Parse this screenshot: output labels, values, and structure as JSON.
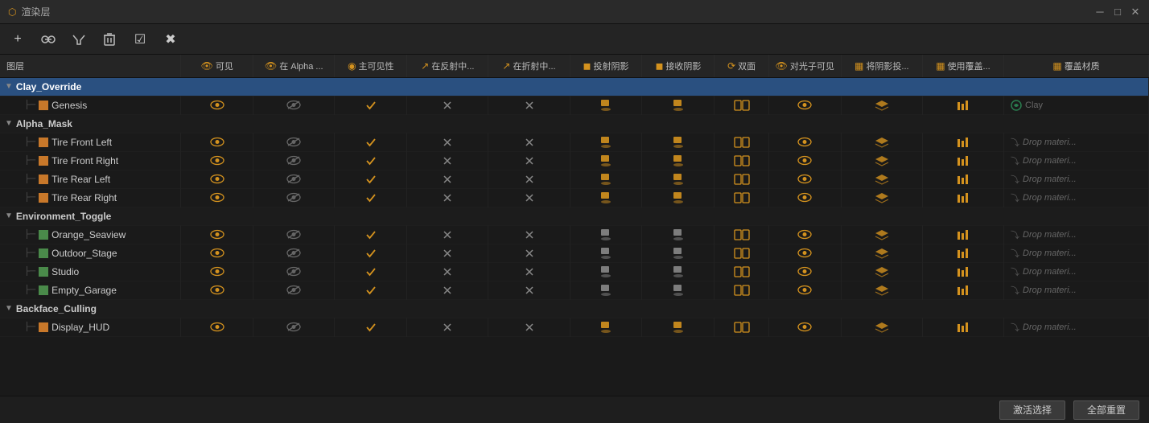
{
  "titlebar": {
    "title": "渲染层",
    "controls": [
      "□",
      "✕"
    ]
  },
  "toolbar": {
    "buttons": [
      "+",
      "⊕",
      "✦",
      "🗑",
      "☑",
      "✖"
    ]
  },
  "table": {
    "headers": [
      {
        "key": "name",
        "label": "图层"
      },
      {
        "key": "visible",
        "label": "可见",
        "icon": "👁"
      },
      {
        "key": "alpha",
        "label": "在 Alpha ...",
        "icon": "👁"
      },
      {
        "key": "mainvis",
        "label": "主可见性",
        "icon": "◉"
      },
      {
        "key": "refl",
        "label": "在反射中...",
        "icon": "↗"
      },
      {
        "key": "refr",
        "label": "在折射中...",
        "icon": "↗"
      },
      {
        "key": "castshadow",
        "label": "投射阴影",
        "icon": "◼"
      },
      {
        "key": "recvshadow",
        "label": "接收阴影",
        "icon": "◼"
      },
      {
        "key": "twosided",
        "label": "双面",
        "icon": "⟳"
      },
      {
        "key": "photovis",
        "label": "对光子可见",
        "icon": "👁"
      },
      {
        "key": "shadowpass",
        "label": "将阴影投...",
        "icon": "◼"
      },
      {
        "key": "usecover",
        "label": "使用覆盖...",
        "icon": "▦"
      },
      {
        "key": "covermaterial",
        "label": "覆盖材质",
        "icon": "▦"
      }
    ],
    "sections": [
      {
        "id": "clay_override",
        "name": "Clay_Override",
        "selected": true,
        "children": [
          {
            "id": "genesis",
            "name": "Genesis",
            "indent": 2,
            "icon_color": "orange",
            "visible": true,
            "alpha": "off",
            "mainvis": true,
            "refl": "x",
            "refr": "x",
            "castshadow": true,
            "recvshadow": true,
            "twosided": true,
            "photovis": true,
            "shadowpass": true,
            "usecover": true,
            "covermaterial": "Clay"
          }
        ]
      },
      {
        "id": "alpha_mask",
        "name": "Alpha_Mask",
        "selected": false,
        "children": [
          {
            "id": "tire_front_left",
            "name": "Tire Front Left",
            "indent": 2,
            "icon_color": "orange",
            "visible": true,
            "alpha": "off",
            "mainvis": true,
            "refl": "x",
            "refr": "x",
            "castshadow": true,
            "recvshadow": true,
            "twosided": true,
            "photovis": true,
            "shadowpass": true,
            "usecover": true,
            "covermaterial": "Drop materi..."
          },
          {
            "id": "tire_front_right",
            "name": "Tire Front Right",
            "indent": 2,
            "icon_color": "orange",
            "visible": true,
            "alpha": "off",
            "mainvis": true,
            "refl": "x",
            "refr": "x",
            "castshadow": true,
            "recvshadow": true,
            "twosided": true,
            "photovis": true,
            "shadowpass": true,
            "usecover": true,
            "covermaterial": "Drop materi..."
          },
          {
            "id": "tire_rear_left",
            "name": "Tire Rear Left",
            "indent": 2,
            "icon_color": "orange",
            "visible": true,
            "alpha": "off",
            "mainvis": true,
            "refl": "x",
            "refr": "x",
            "castshadow": true,
            "recvshadow": true,
            "twosided": true,
            "photovis": true,
            "shadowpass": true,
            "usecover": true,
            "covermaterial": "Drop materi..."
          },
          {
            "id": "tire_rear_right",
            "name": "Tire Rear Right",
            "indent": 2,
            "icon_color": "orange",
            "visible": true,
            "alpha": "off",
            "mainvis": true,
            "refl": "x",
            "refr": "x",
            "castshadow": true,
            "recvshadow": true,
            "twosided": true,
            "photovis": true,
            "shadowpass": true,
            "usecover": true,
            "covermaterial": "Drop materi..."
          }
        ]
      },
      {
        "id": "environment_toggle",
        "name": "Environment_Toggle",
        "selected": false,
        "children": [
          {
            "id": "orange_seaview",
            "name": "Orange_Seaview",
            "indent": 2,
            "icon_color": "green",
            "visible": true,
            "alpha": "off",
            "mainvis": true,
            "refl": "x",
            "refr": "x",
            "castshadow": "gray",
            "recvshadow": "gray",
            "twosided": true,
            "photovis": true,
            "shadowpass": true,
            "usecover": true,
            "covermaterial": "Drop materi..."
          },
          {
            "id": "outdoor_stage",
            "name": "Outdoor_Stage",
            "indent": 2,
            "icon_color": "green",
            "visible": true,
            "alpha": "off",
            "mainvis": true,
            "refl": "x",
            "refr": "x",
            "castshadow": "gray",
            "recvshadow": "gray",
            "twosided": true,
            "photovis": true,
            "shadowpass": true,
            "usecover": true,
            "covermaterial": "Drop materi..."
          },
          {
            "id": "studio",
            "name": "Studio",
            "indent": 2,
            "icon_color": "green",
            "visible": true,
            "alpha": "off",
            "mainvis": true,
            "refl": "x",
            "refr": "x",
            "castshadow": "gray",
            "recvshadow": "gray",
            "twosided": true,
            "photovis": true,
            "shadowpass": true,
            "usecover": true,
            "covermaterial": "Drop materi..."
          },
          {
            "id": "empty_garage",
            "name": "Empty_Garage",
            "indent": 2,
            "icon_color": "green",
            "visible": true,
            "alpha": "off",
            "mainvis": true,
            "refl": "x",
            "refr": "x",
            "castshadow": "gray",
            "recvshadow": "gray",
            "twosided": true,
            "photovis": true,
            "shadowpass": true,
            "usecover": true,
            "covermaterial": "Drop materi..."
          }
        ]
      },
      {
        "id": "backface_culling",
        "name": "Backface_Culling",
        "selected": false,
        "children": [
          {
            "id": "display_hud",
            "name": "Display_HUD",
            "indent": 2,
            "icon_color": "orange",
            "visible": true,
            "alpha": "off",
            "mainvis": true,
            "refl": "x",
            "refr": "x",
            "castshadow": true,
            "recvshadow": true,
            "twosided": true,
            "photovis": true,
            "shadowpass": true,
            "usecover": true,
            "covermaterial": "Drop materi..."
          }
        ]
      }
    ]
  },
  "bottombar": {
    "activate_label": "激活选择",
    "reset_label": "全部重置"
  }
}
